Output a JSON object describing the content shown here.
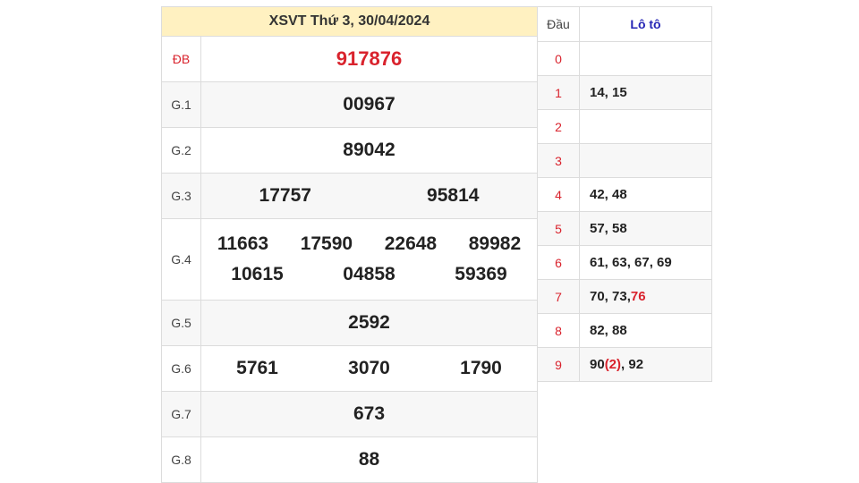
{
  "colors": {
    "accent_red": "#d9232d",
    "header_bg": "#fff1c1",
    "loto_header_blue": "#2525b5"
  },
  "results": {
    "title": "XSVT Thứ 3, 30/04/2024",
    "prizes": {
      "db": {
        "name": "ĐB",
        "lines": [
          [
            "917876"
          ]
        ]
      },
      "g1": {
        "name": "G.1",
        "lines": [
          [
            "00967"
          ]
        ]
      },
      "g2": {
        "name": "G.2",
        "lines": [
          [
            "89042"
          ]
        ]
      },
      "g3": {
        "name": "G.3",
        "lines": [
          [
            "17757",
            "95814"
          ]
        ]
      },
      "g4": {
        "name": "G.4",
        "lines": [
          [
            "11663",
            "17590",
            "22648",
            "89982"
          ],
          [
            "10615",
            "04858",
            "59369"
          ]
        ]
      },
      "g5": {
        "name": "G.5",
        "lines": [
          [
            "2592"
          ]
        ]
      },
      "g6": {
        "name": "G.6",
        "lines": [
          [
            "5761",
            "3070",
            "1790"
          ]
        ]
      },
      "g7": {
        "name": "G.7",
        "lines": [
          [
            "673"
          ]
        ]
      },
      "g8": {
        "name": "G.8",
        "lines": [
          [
            "88"
          ]
        ]
      }
    }
  },
  "loto": {
    "header_dau": "Đầu",
    "header_loto": "Lô tô",
    "rows": [
      {
        "dau": "0",
        "parts": []
      },
      {
        "dau": "1",
        "parts": [
          {
            "t": "14, 15"
          }
        ]
      },
      {
        "dau": "2",
        "parts": []
      },
      {
        "dau": "3",
        "parts": []
      },
      {
        "dau": "4",
        "parts": [
          {
            "t": "42, 48"
          }
        ]
      },
      {
        "dau": "5",
        "parts": [
          {
            "t": "57, 58"
          }
        ]
      },
      {
        "dau": "6",
        "parts": [
          {
            "t": "61, 63, 67, 69"
          }
        ]
      },
      {
        "dau": "7",
        "parts": [
          {
            "t": "70, 73, "
          },
          {
            "t": "76",
            "hl": true
          }
        ]
      },
      {
        "dau": "8",
        "parts": [
          {
            "t": "82, 88"
          }
        ]
      },
      {
        "dau": "9",
        "parts": [
          {
            "t": "90"
          },
          {
            "t": "(2)",
            "hl": true
          },
          {
            "t": ", 92"
          }
        ]
      }
    ]
  }
}
